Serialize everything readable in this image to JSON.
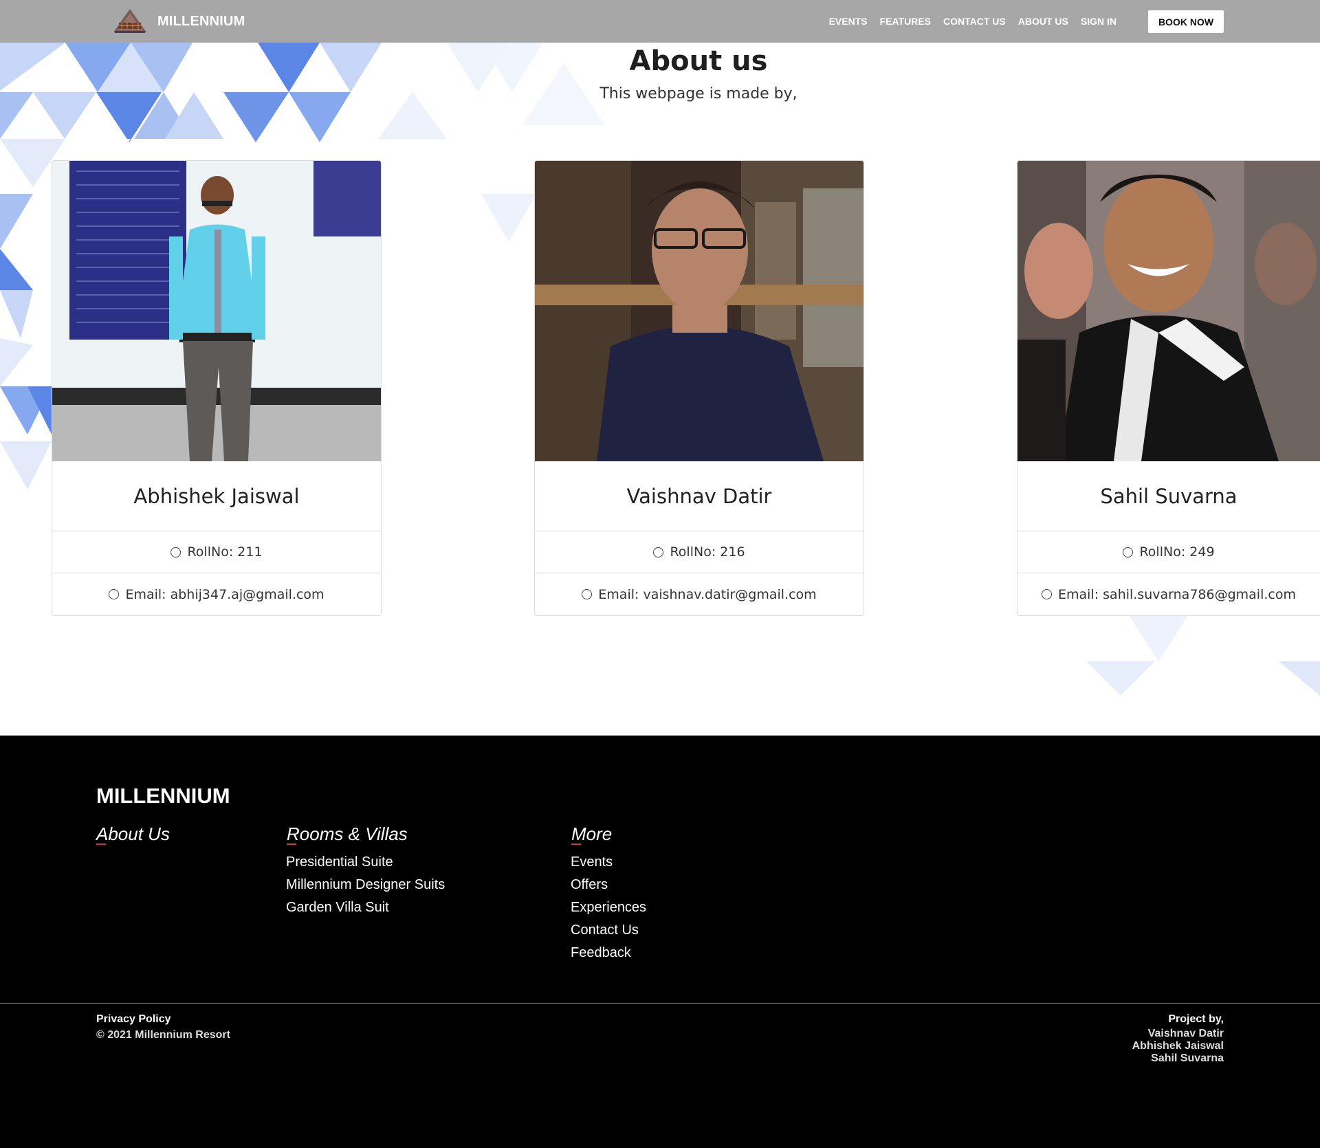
{
  "navbar": {
    "brand": "MILLENNIUM",
    "links": [
      "EVENTS",
      "FEATURES",
      "CONTACT US",
      "ABOUT US",
      "SIGN IN"
    ],
    "book_button": "BOOK NOW"
  },
  "header": {
    "title": "About us",
    "subtitle": "This webpage is made by,"
  },
  "cards": [
    {
      "name": "Abhishek Jaiswal",
      "roll": "RollNo: 211",
      "email": "Email: abhij347.aj@gmail.com"
    },
    {
      "name": "Vaishnav Datir",
      "roll": "RollNo: 216",
      "email": "Email: vaishnav.datir@gmail.com"
    },
    {
      "name": "Sahil Suvarna",
      "roll": "RollNo: 249",
      "email": "Email: sahil.suvarna786@gmail.com"
    }
  ],
  "footer": {
    "brand": "MILLENNIUM",
    "about_heading": "About Us",
    "rooms_heading": "Rooms & Villas",
    "rooms_links": [
      "Presidential Suite",
      "Millennium Designer Suits",
      "Garden Villa Suit"
    ],
    "more_heading": "More",
    "more_links": [
      "Events",
      "Offers",
      "Experiences",
      "Contact Us",
      "Feedback"
    ],
    "privacy": "Privacy Policy",
    "copyright": "© 2021 Millennium Resort",
    "project_by": "Project by,",
    "project_names": [
      "Vaishnav Datir",
      "Abhishek Jaiswal",
      "Sahil Suvarna"
    ]
  },
  "colors": {
    "navbar_bg": "#a7a7a7",
    "footer_bg": "#000000",
    "accent_triangles": "#5b86e5",
    "footer_divider": "#b35a1f"
  }
}
